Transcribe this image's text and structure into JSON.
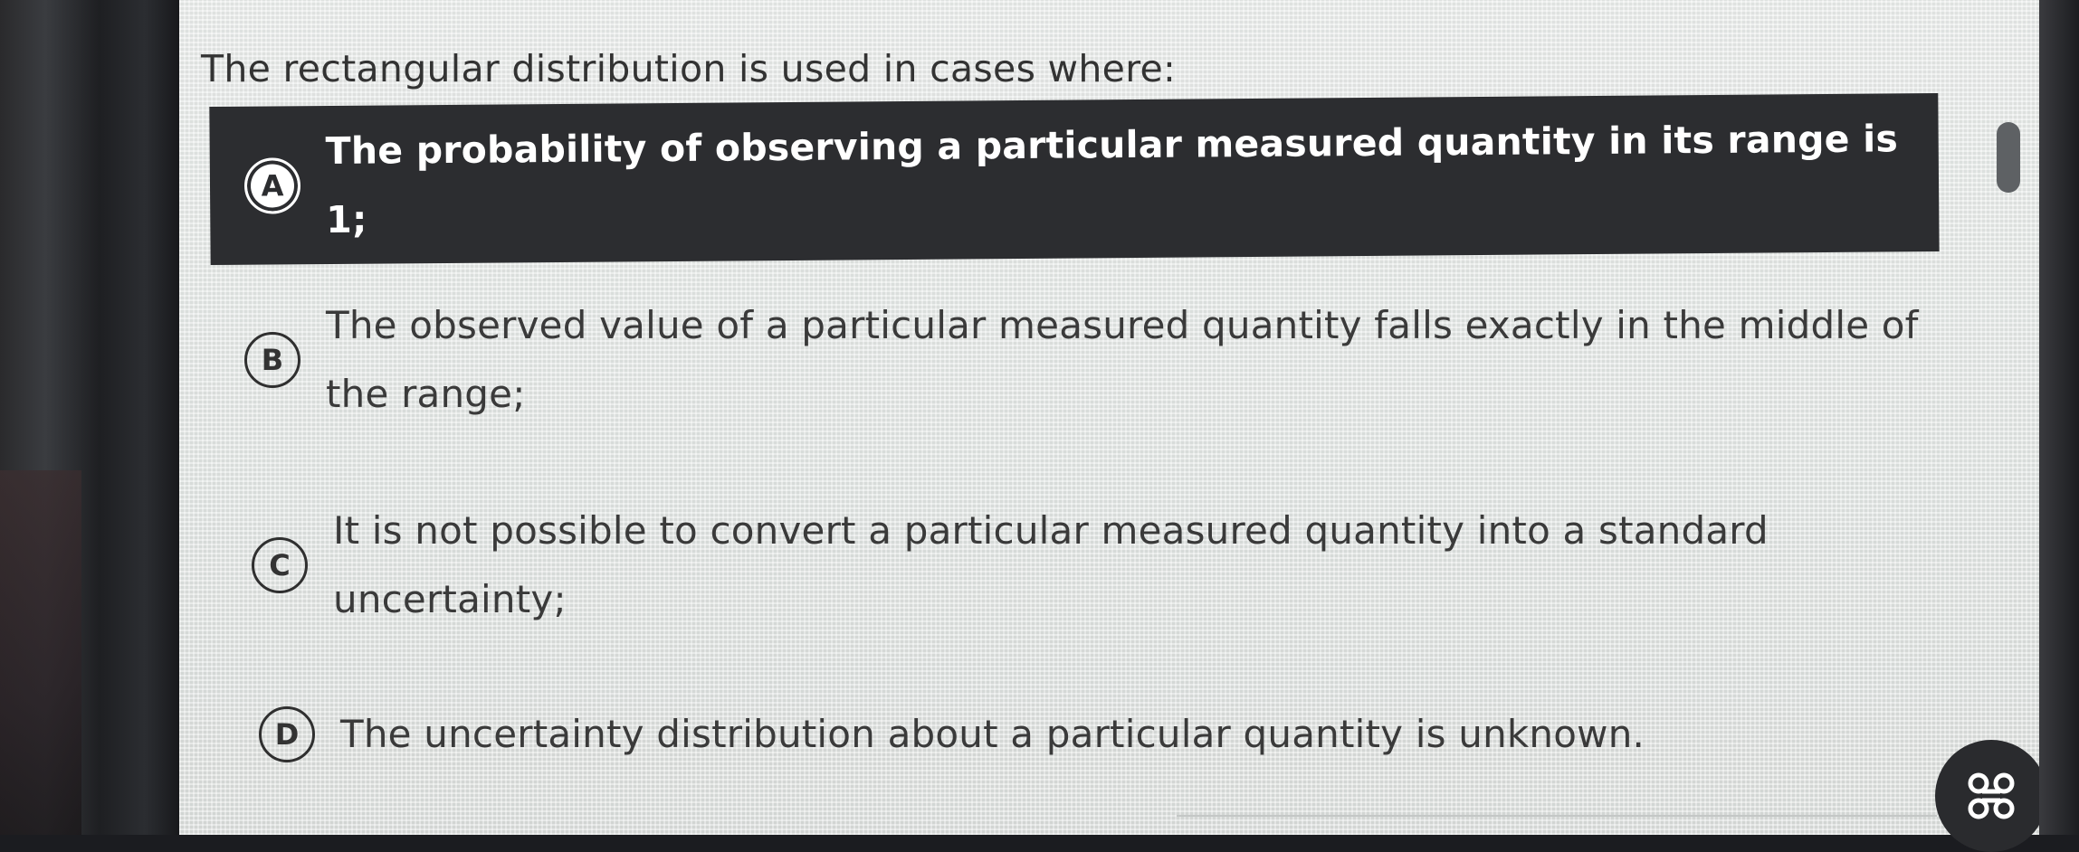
{
  "question": {
    "text": "The rectangular distribution is used in cases where:"
  },
  "options": [
    {
      "letter": "A",
      "text": "The probability of observing a particular measured quantity in its range is 1;",
      "selected": true
    },
    {
      "letter": "B",
      "text": "The observed value of a particular measured quantity falls exactly in the middle of the range;",
      "selected": false
    },
    {
      "letter": "C",
      "text": "It is not possible to convert a particular measured quantity into a standard uncertainty;",
      "selected": false
    },
    {
      "letter": "D",
      "text": "The uncertainty distribution about a particular quantity is unknown.",
      "selected": false
    }
  ],
  "icons": {
    "menu_button": "command-icon"
  },
  "colors": {
    "selected_background": "#2c2d30",
    "selected_text": "#ffffff",
    "page_background": "#e4e7e6"
  }
}
